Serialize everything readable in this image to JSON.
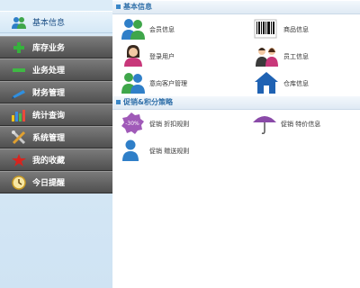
{
  "sidebar": {
    "items": [
      {
        "label": "基本信息",
        "icon": "users-icon",
        "active": true
      },
      {
        "label": "库存业务",
        "icon": "plus-icon"
      },
      {
        "label": "业务处理",
        "icon": "minus-icon"
      },
      {
        "label": "财务管理",
        "icon": "pencil-icon"
      },
      {
        "label": "统计查询",
        "icon": "bar-chart-icon"
      },
      {
        "label": "系统管理",
        "icon": "tools-icon"
      },
      {
        "label": "我的收藏",
        "icon": "star-icon"
      },
      {
        "label": "今日提醒",
        "icon": "clock-icon"
      }
    ]
  },
  "sections": [
    {
      "title": "基本信息",
      "tiles": [
        {
          "label": "会员信息",
          "icon": "members-icon"
        },
        {
          "label": "商品信息",
          "icon": "barcode-icon"
        },
        {
          "label": "登录用户",
          "icon": "login-user-icon"
        },
        {
          "label": "员工信息",
          "icon": "staff-icon"
        },
        {
          "label": "意向客户管理",
          "icon": "prospect-customers-icon"
        },
        {
          "label": "仓库信息",
          "icon": "warehouse-icon"
        }
      ]
    },
    {
      "title": "促销&积分策略",
      "tiles": [
        {
          "label": "促销 折扣规则",
          "icon": "discount-tag-icon",
          "badge": "-30%"
        },
        {
          "label": "促销 特价信息",
          "icon": "umbrella-icon"
        },
        {
          "label": "促销 赠送规则",
          "icon": "gift-user-icon"
        }
      ]
    }
  ],
  "colors": {
    "sidebar_bg": "#d4e6f5",
    "nav_dark": "#5f5f5f",
    "nav_active_text": "#1c4f86",
    "section_title": "#2e6ea8"
  }
}
